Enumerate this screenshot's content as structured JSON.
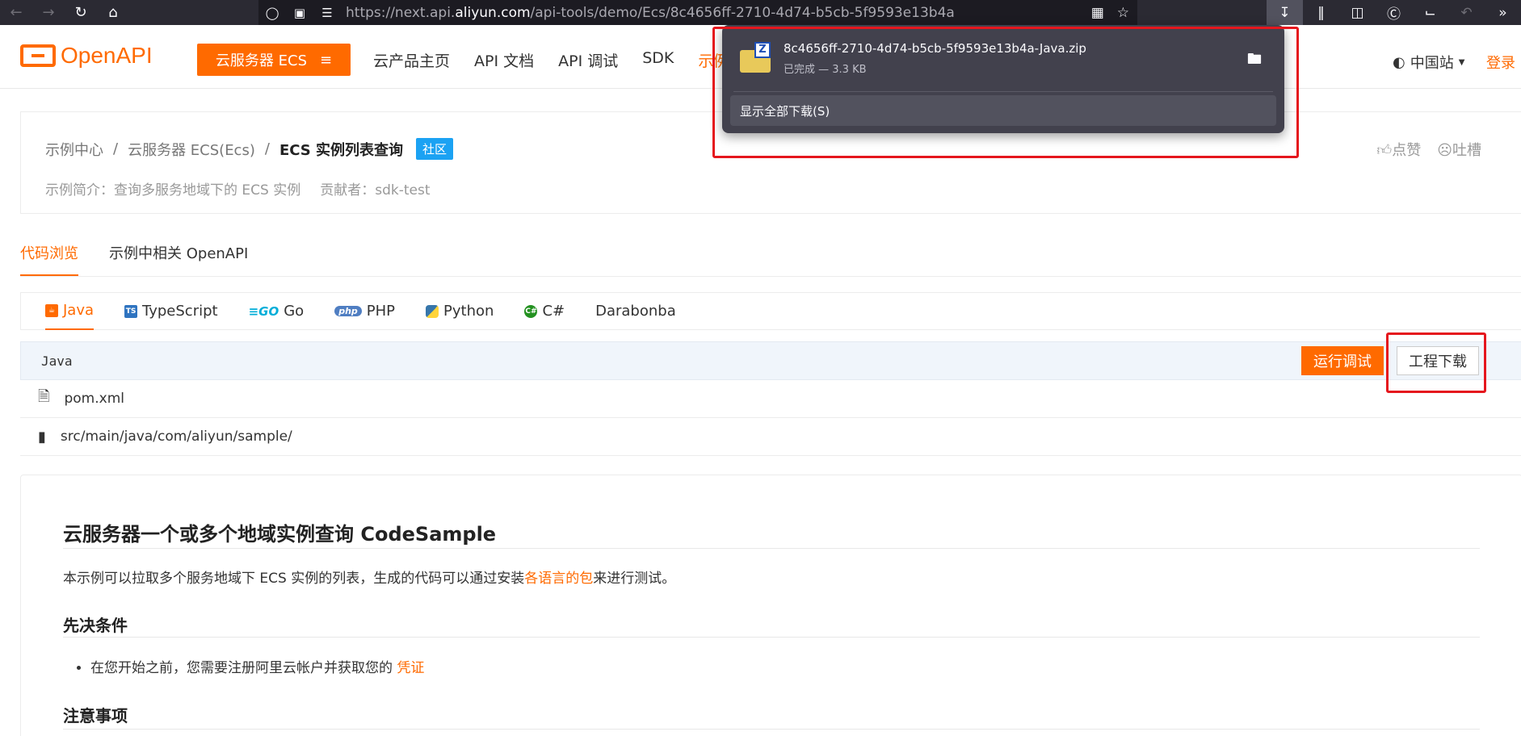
{
  "browser": {
    "url_prefix": "https://next.api.",
    "url_domain": "aliyun.com",
    "url_path": "/api-tools/demo/Ecs/8c4656ff-2710-4d74-b5cb-5f9593e13b4a"
  },
  "header": {
    "logo_text": "OpenAPI",
    "product_button": "云服务器 ECS",
    "nav": [
      "云产品主页",
      "API 文档",
      "API 调试",
      "SDK",
      "示例"
    ],
    "region": "中国站",
    "login": "登录"
  },
  "breadcrumb": {
    "items": [
      "示例中心",
      "云服务器 ECS(Ecs)",
      "ECS 实例列表查询"
    ],
    "separator": "/",
    "badge": "社区"
  },
  "description": {
    "intro": "示例简介：查询多服务地域下的 ECS 实例",
    "contributor": "贡献者：sdk-test"
  },
  "actions": {
    "like": "点赞",
    "complain": "吐槽"
  },
  "tabs": [
    "代码浏览",
    "示例中相关 OpenAPI"
  ],
  "languages": [
    "Java",
    "TypeScript",
    "Go",
    "PHP",
    "Python",
    "C#",
    "Darabonba"
  ],
  "code_head": {
    "label": "Java",
    "run_button": "运行调试",
    "download_button": "工程下载"
  },
  "files": [
    {
      "name": "pom.xml",
      "icon": "file-icon"
    },
    {
      "name": "src/main/java/com/aliyun/sample/",
      "icon": "folder-icon"
    }
  ],
  "readme": {
    "title": "云服务器一个或多个地域实例查询 CodeSample",
    "intro_before": "本示例可以拉取多个服务地域下 ECS 实例的列表，生成的代码可以通过安装",
    "intro_link": "各语言的包",
    "intro_after": "来进行测试。",
    "h_prereq": "先决条件",
    "prereq_item": "在您开始之前，您需要注册阿里云帐户并获取您的 ",
    "prereq_link": "凭证",
    "h_notes": "注意事项"
  },
  "download_panel": {
    "filename": "8c4656ff-2710-4d74-b5cb-5f9593e13b4a-Java.zip",
    "status": "已完成 — 3.3 KB",
    "show_all": "显示全部下载(S)"
  },
  "colors": {
    "accent": "#ff6a00",
    "highlight": "#e5161d",
    "badge": "#1ba2f3"
  }
}
